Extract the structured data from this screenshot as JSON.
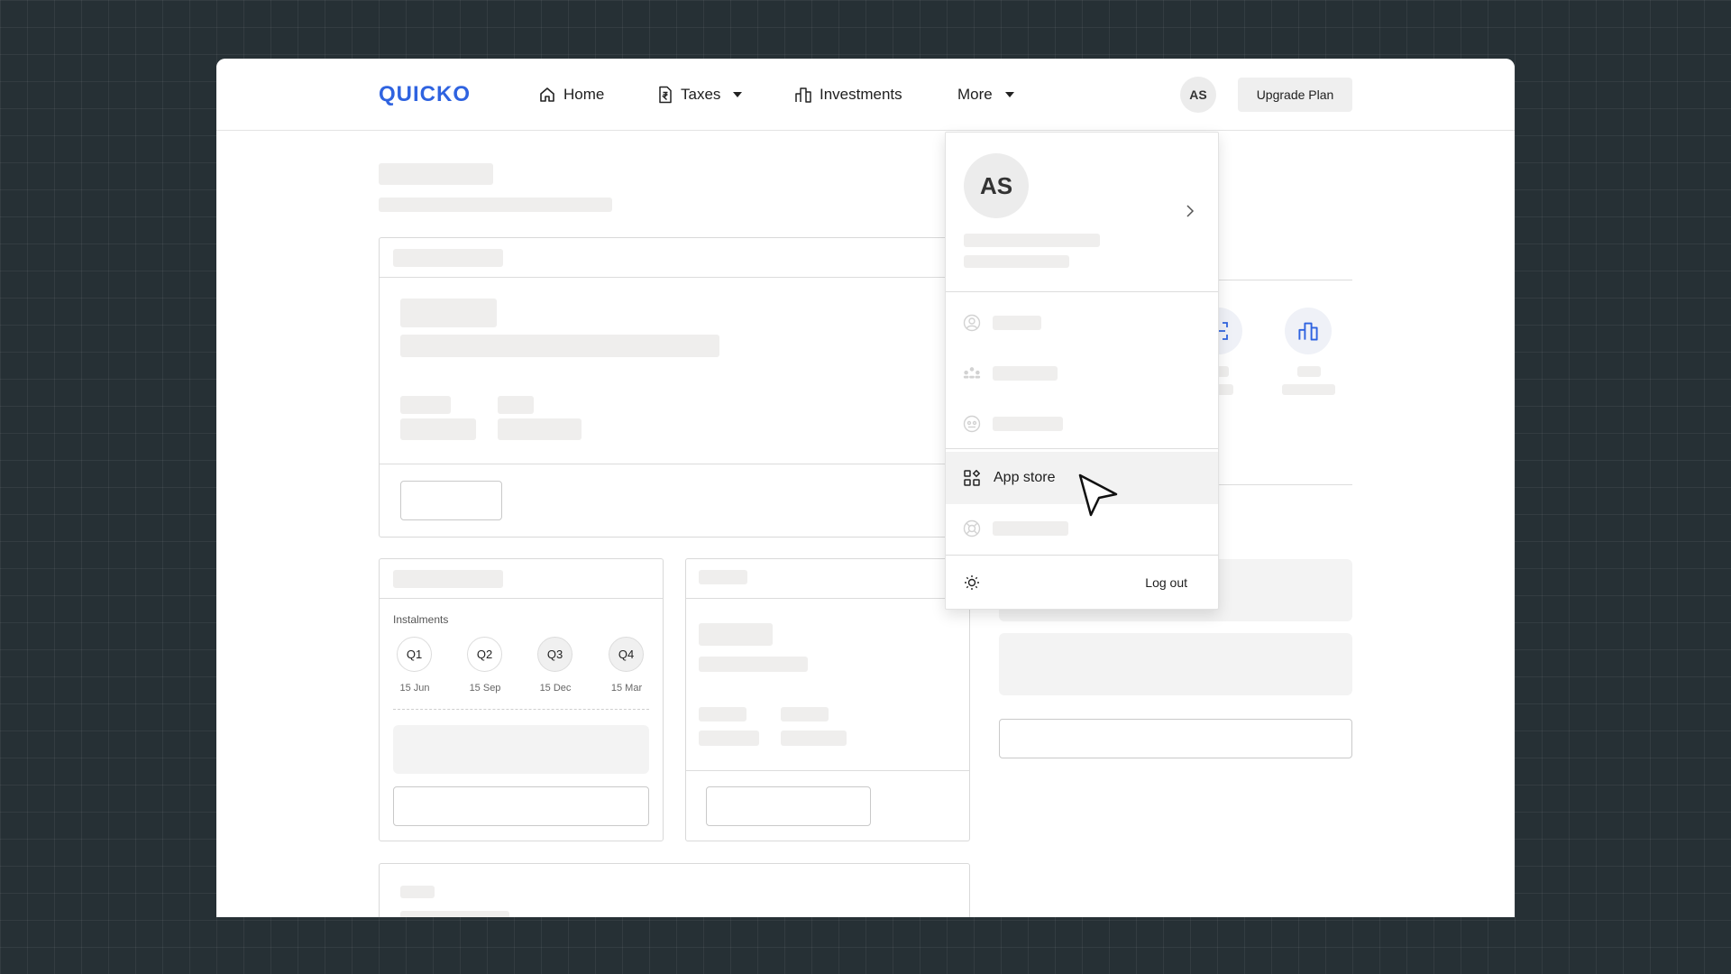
{
  "brand": {
    "logo_text": "QUICKO",
    "accent": "#2f63e0"
  },
  "navbar": {
    "home_label": "Home",
    "taxes_label": "Taxes",
    "investments_label": "Investments",
    "more_label": "More",
    "avatar_initials": "AS",
    "upgrade_label": "Upgrade Plan",
    "icons": [
      "home-icon",
      "tax-document-icon",
      "investments-icon",
      "chevron-down-icon"
    ]
  },
  "instalments": {
    "title": "Instalments",
    "quarters": [
      {
        "label": "Q1",
        "date": "15 Jun"
      },
      {
        "label": "Q2",
        "date": "15 Sep"
      },
      {
        "label": "Q3",
        "date": "15 Dec"
      },
      {
        "label": "Q4",
        "date": "15 Mar"
      }
    ]
  },
  "dropdown": {
    "avatar_initials": "AS",
    "app_store_label": "App store",
    "logout_label": "Log out",
    "icons": [
      "user-icon",
      "team-icon",
      "settings-icon",
      "app-store-icon",
      "help-icon",
      "theme-sun-icon",
      "chevron-right-icon"
    ]
  },
  "colors": {
    "background": "#263035",
    "skeleton": "#efeeed",
    "active_row": "#f2f2f2"
  }
}
